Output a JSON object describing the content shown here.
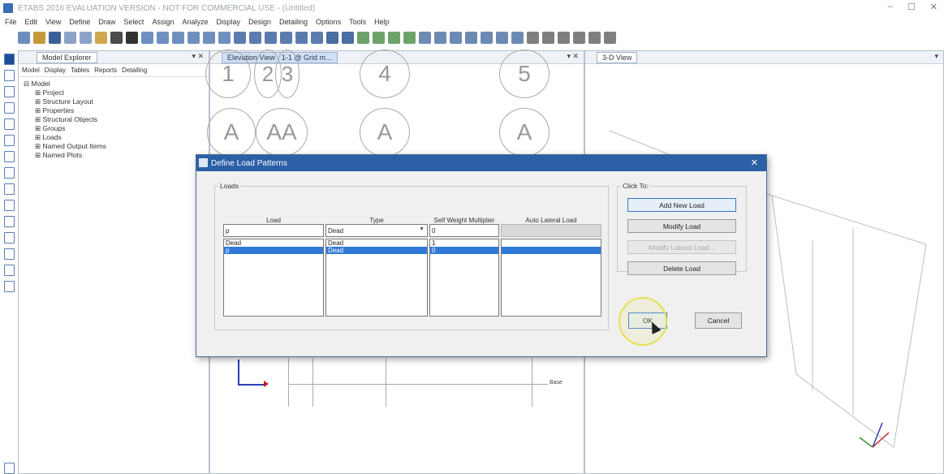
{
  "window": {
    "title": "ETABS 2016 EVALUATION VERSION - NOT FOR COMMERCIAL USE - (Untitled)",
    "controls": [
      "–",
      "☐",
      "✕"
    ]
  },
  "menu": [
    "File",
    "Edit",
    "View",
    "Define",
    "Draw",
    "Select",
    "Assign",
    "Analyze",
    "Display",
    "Design",
    "Detailing",
    "Options",
    "Tools",
    "Help"
  ],
  "explorer": {
    "tab_title": "Model Explorer",
    "pin": "▾ ✕",
    "tabs": [
      "Model",
      "Display",
      "Tables",
      "Reports",
      "Detailing"
    ],
    "root": "Model",
    "children": [
      "Project",
      "Structure Layout",
      "Properties",
      "Structural Objects",
      "Groups",
      "Loads",
      "Named Output Items",
      "Named Plots"
    ]
  },
  "elevation": {
    "tab_title": "Elevation View - 1-1 @ Grid m...",
    "pin": "▾ ✕",
    "grid_numbers": [
      "1",
      "2",
      "3",
      "4",
      "5"
    ],
    "grid_letters": [
      "A",
      "AA",
      "A",
      "A"
    ],
    "frame_label": "Base",
    "axis_labels": [
      "Z",
      "X"
    ]
  },
  "view3d": {
    "tab_title": "3-D View",
    "pin": "▾"
  },
  "dialog": {
    "title": "Define Load Patterns",
    "close": "✕",
    "loads_group_label": "Loads",
    "columns": {
      "load": "Load",
      "type": "Type",
      "self_weight": "Self Weight Multiplier",
      "auto_lateral": "Auto Lateral Load"
    },
    "input": {
      "load": "p",
      "type": "Dead",
      "self_weight": "0",
      "auto_lateral": ""
    },
    "rows": [
      {
        "load": "Dead",
        "type": "Dead",
        "self_weight": "1",
        "auto_lateral": "",
        "selected": false
      },
      {
        "load": "p",
        "type": "Dead",
        "self_weight": "0",
        "auto_lateral": "",
        "selected": true
      }
    ],
    "click_to_label": "Click To:",
    "buttons": {
      "add_new": "Add New Load",
      "modify": "Modify Load",
      "modify_lateral": "Modify Lateral Load...",
      "delete": "Delete Load",
      "ok": "OK",
      "cancel": "Cancel"
    }
  }
}
